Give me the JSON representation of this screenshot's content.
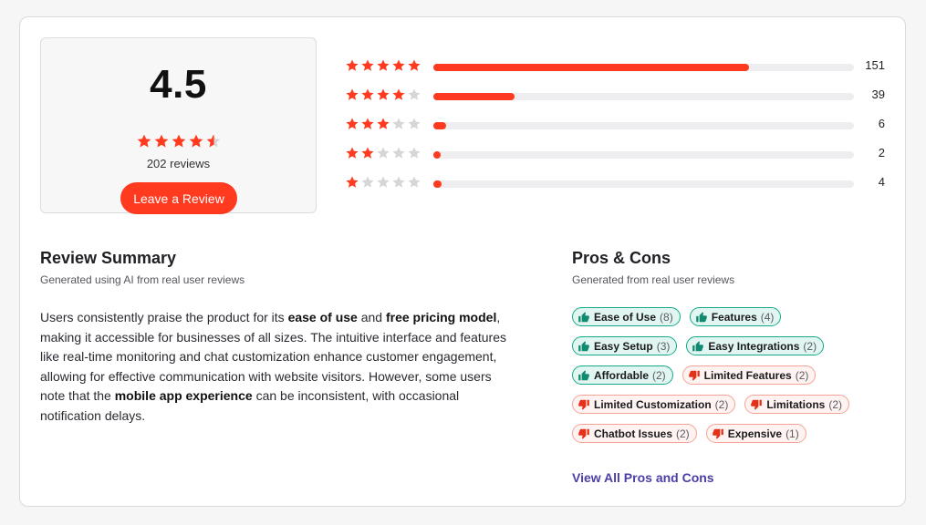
{
  "rating": {
    "score": "4.5",
    "stars": [
      "full",
      "full",
      "full",
      "full",
      "half"
    ],
    "review_count": "202 reviews",
    "leave_review_label": "Leave a Review"
  },
  "distribution": [
    {
      "stars": 5,
      "count": "151",
      "fraction": 0.75
    },
    {
      "stars": 4,
      "count": "39",
      "fraction": 0.194
    },
    {
      "stars": 3,
      "count": "6",
      "fraction": 0.03
    },
    {
      "stars": 2,
      "count": "2",
      "fraction": 0.01
    },
    {
      "stars": 1,
      "count": "4",
      "fraction": 0.02
    }
  ],
  "summary": {
    "title": "Review Summary",
    "subtitle": "Generated using AI from real user reviews",
    "segments": [
      {
        "text": "Users consistently praise the product for its ",
        "bold": false
      },
      {
        "text": "ease of use",
        "bold": true
      },
      {
        "text": " and ",
        "bold": false
      },
      {
        "text": "free pricing model",
        "bold": true
      },
      {
        "text": ", making it accessible for businesses of all sizes. The intuitive interface and features like real-time monitoring and chat customization enhance customer engagement, allowing for effective communication with website visitors. However, some users note that the ",
        "bold": false
      },
      {
        "text": "mobile app experience",
        "bold": true
      },
      {
        "text": " can be inconsistent, with occasional notification delays.",
        "bold": false
      }
    ]
  },
  "pros_cons": {
    "title": "Pros & Cons",
    "subtitle": "Generated from real user reviews",
    "rows": [
      [
        {
          "type": "pro",
          "label": "Ease of Use",
          "count": "(8)"
        },
        {
          "type": "pro",
          "label": "Features",
          "count": "(4)"
        }
      ],
      [
        {
          "type": "pro",
          "label": "Easy Setup",
          "count": "(3)"
        },
        {
          "type": "pro",
          "label": "Easy Integrations",
          "count": "(2)"
        }
      ],
      [
        {
          "type": "pro",
          "label": "Affordable",
          "count": "(2)"
        },
        {
          "type": "con",
          "label": "Limited Features",
          "count": "(2)"
        }
      ],
      [
        {
          "type": "con",
          "label": "Limited Customization",
          "count": "(2)"
        },
        {
          "type": "con",
          "label": "Limitations",
          "count": "(2)"
        }
      ],
      [
        {
          "type": "con",
          "label": "Chatbot Issues",
          "count": "(2)"
        },
        {
          "type": "con",
          "label": "Expensive",
          "count": "(1)"
        }
      ]
    ],
    "view_all_label": "View All Pros and Cons"
  },
  "colors": {
    "accent_red": "#ff3a1f",
    "star_empty": "#d6d6da",
    "pro_icon": "#108a70",
    "con_icon": "#e5311a",
    "link": "#4a3fa8"
  },
  "icons": {
    "pro": "thumbs-up-icon",
    "con": "thumbs-down-icon",
    "star": "star-icon"
  }
}
